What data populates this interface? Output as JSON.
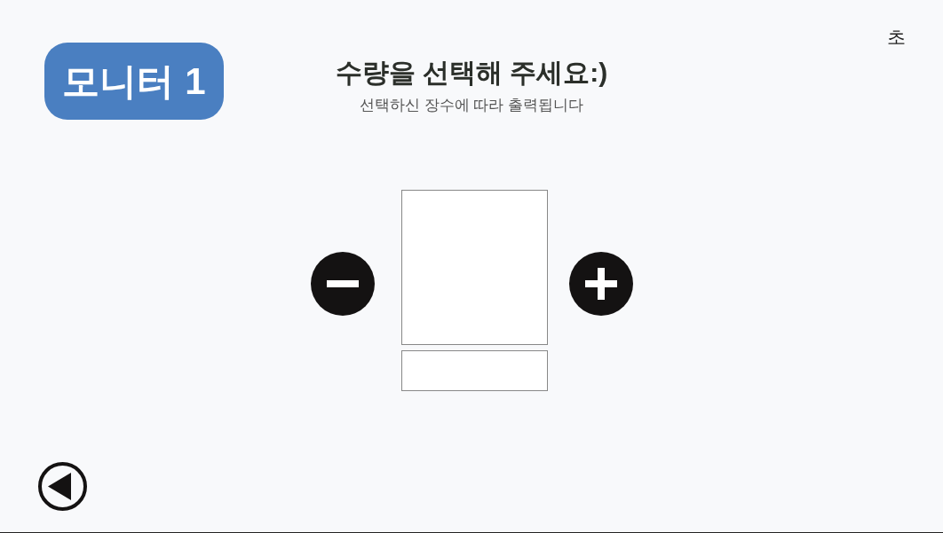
{
  "header": {
    "badge": "모니터 1",
    "title": "수량을 선택해 주세요:)",
    "subtitle": "선택하신 장수에 따라 출력됩니다",
    "timer": "초"
  }
}
